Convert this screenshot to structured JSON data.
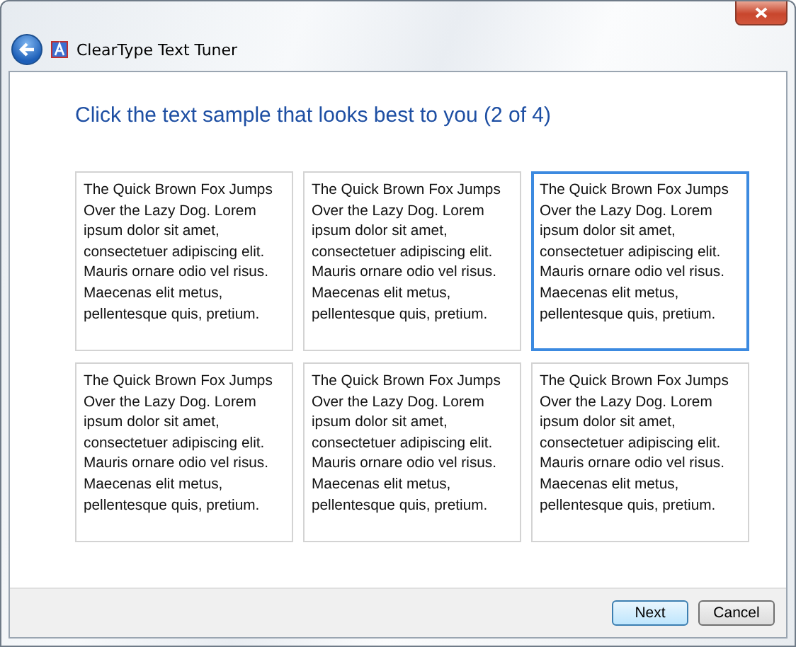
{
  "window": {
    "title": "ClearType Text Tuner"
  },
  "heading": "Click the text sample that looks best to you (2 of 4)",
  "samples": [
    {
      "text": "The Quick Brown Fox Jumps Over the Lazy Dog. Lorem ipsum dolor sit amet, consectetuer adipiscing elit. Mauris ornare odio vel risus. Maecenas elit metus, pellentesque quis, pretium.",
      "selected": false
    },
    {
      "text": "The Quick Brown Fox Jumps Over the Lazy Dog. Lorem ipsum dolor sit amet, consectetuer adipiscing elit. Mauris ornare odio vel risus. Maecenas elit metus, pellentesque quis, pretium.",
      "selected": false
    },
    {
      "text": "The Quick Brown Fox Jumps Over the Lazy Dog. Lorem ipsum dolor sit amet, consectetuer adipiscing elit. Mauris ornare odio vel risus. Maecenas elit metus, pellentesque quis, pretium.",
      "selected": true
    },
    {
      "text": "The Quick Brown Fox Jumps Over the Lazy Dog. Lorem ipsum dolor sit amet, consectetuer adipiscing elit. Mauris ornare odio vel risus. Maecenas elit metus, pellentesque quis, pretium.",
      "selected": false
    },
    {
      "text": "The Quick Brown Fox Jumps Over the Lazy Dog. Lorem ipsum dolor sit amet, consectetuer adipiscing elit. Mauris ornare odio vel risus. Maecenas elit metus, pellentesque quis, pretium.",
      "selected": false
    },
    {
      "text": "The Quick Brown Fox Jumps Over the Lazy Dog. Lorem ipsum dolor sit amet, consectetuer adipiscing elit. Mauris ornare odio vel risus. Maecenas elit metus, pellentesque quis, pretium.",
      "selected": false
    }
  ],
  "buttons": [
    {
      "label": "Next",
      "kind": "default"
    },
    {
      "label": "Cancel",
      "kind": "normal"
    }
  ]
}
